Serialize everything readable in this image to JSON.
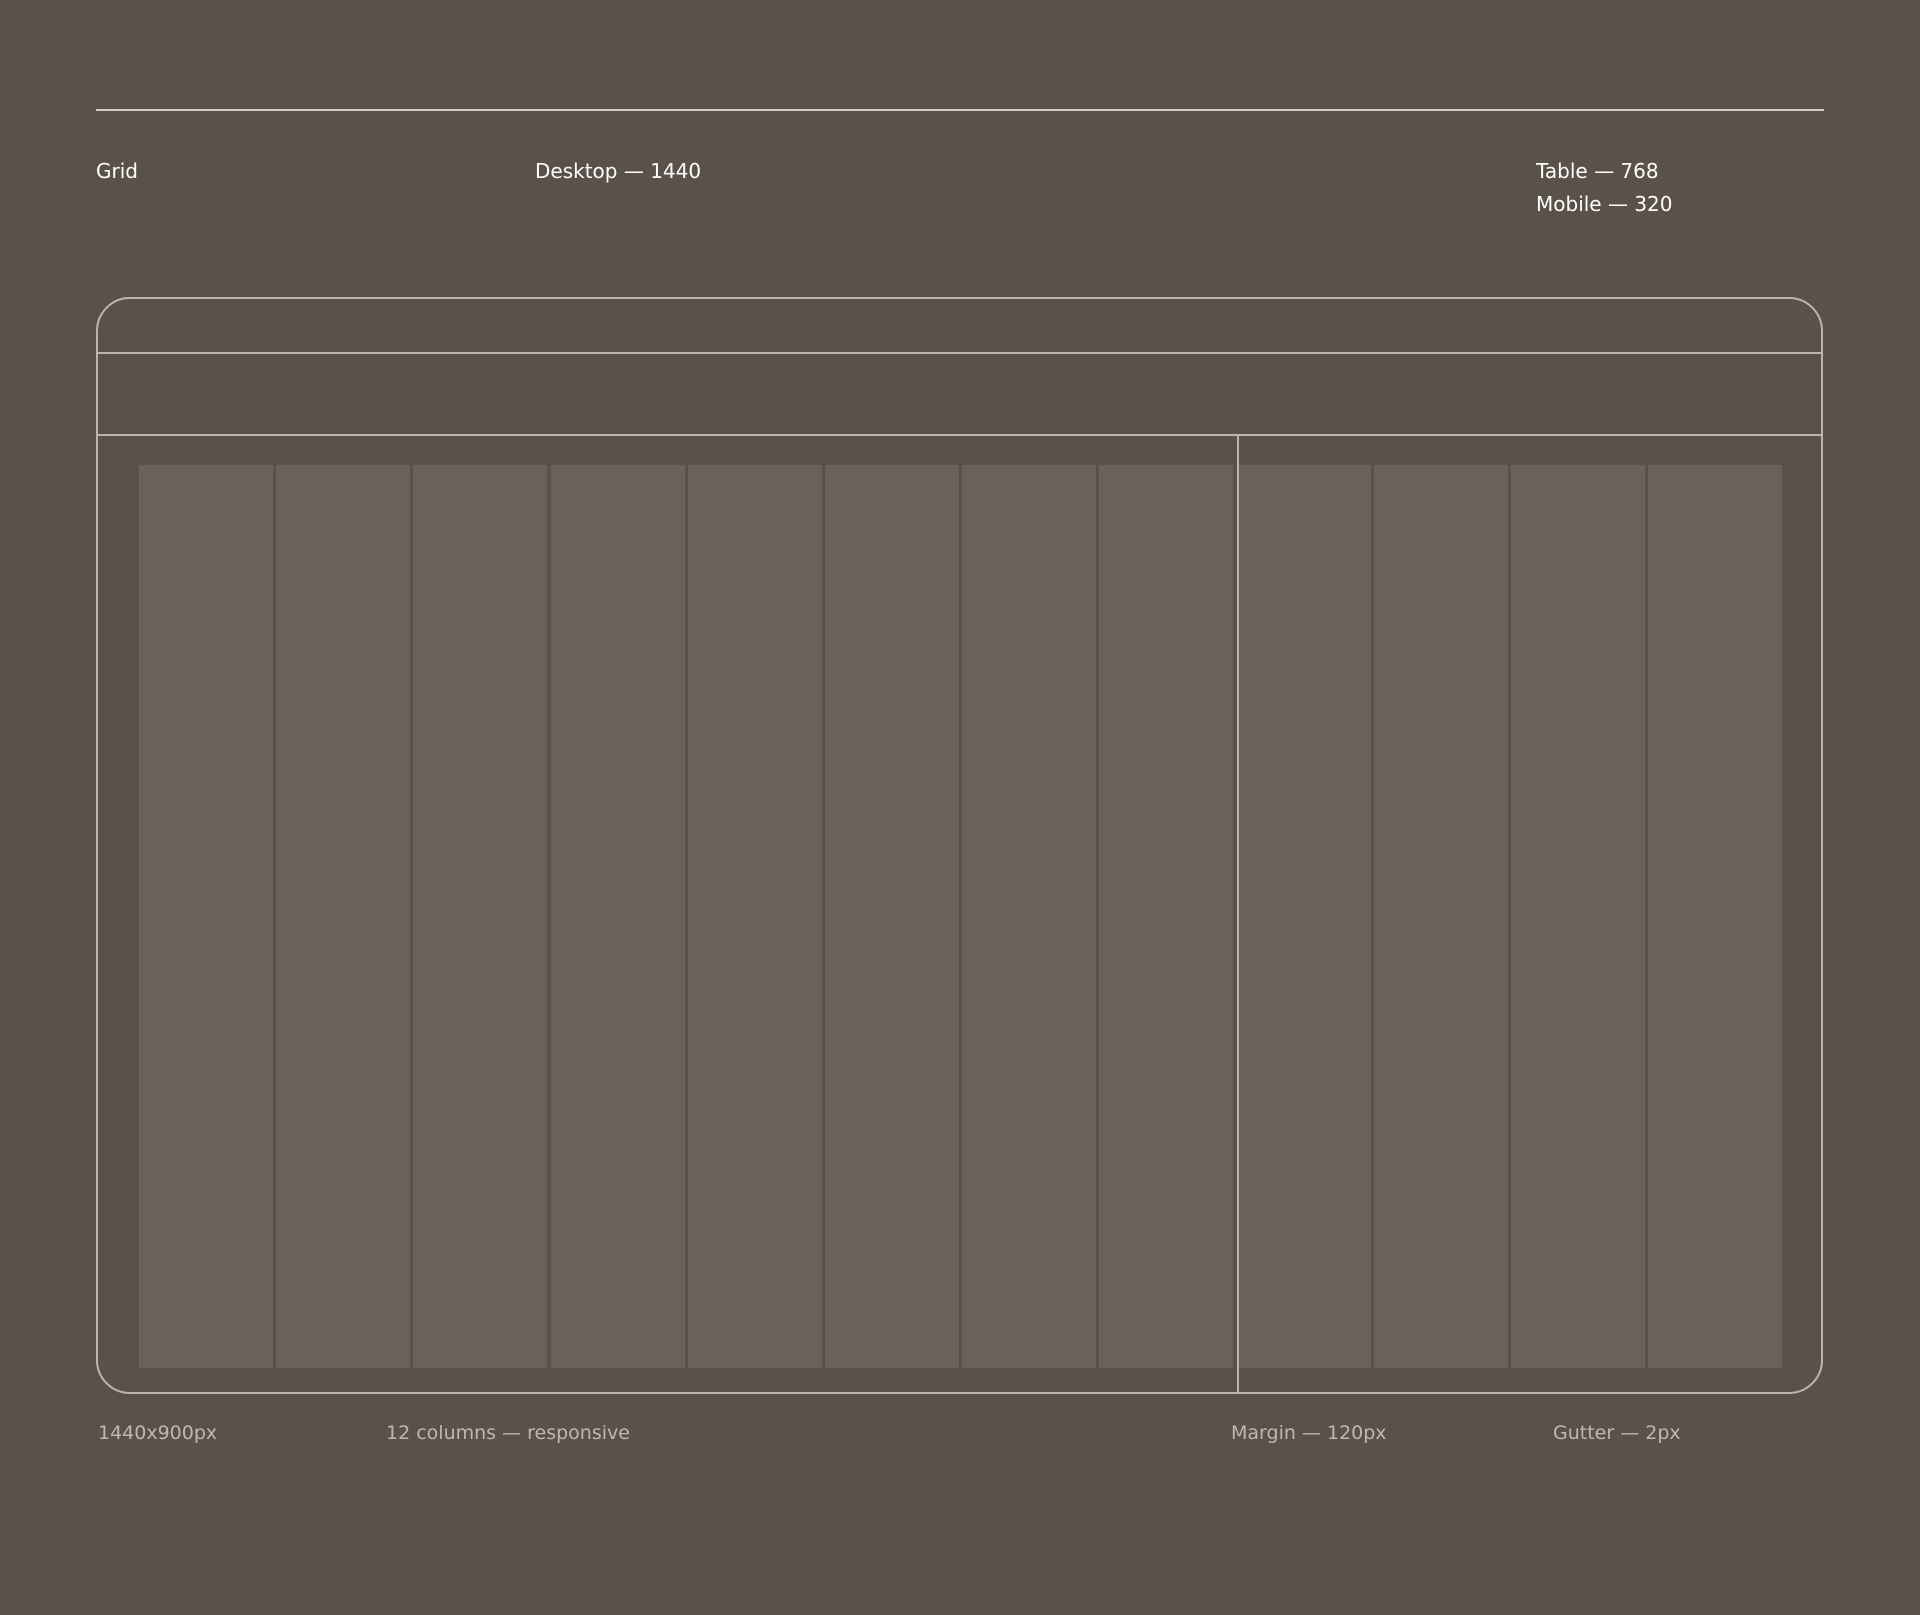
{
  "header": {
    "title": "Grid",
    "desktop": "Desktop — 1440",
    "tablet": "Table — 768",
    "mobile": "Mobile — 320"
  },
  "grid": {
    "column_count": 12
  },
  "footer": {
    "size": "1440x900px",
    "columns": "12 columns — responsive",
    "margin": "Margin — 120px",
    "gutter": "Gutter — 2px"
  },
  "colors": {
    "background": "#5a5249",
    "column_fill": "#6a6259",
    "outline": "#b9b6b0",
    "header_text": "#ffffff",
    "footer_text": "#bdb8b1"
  }
}
